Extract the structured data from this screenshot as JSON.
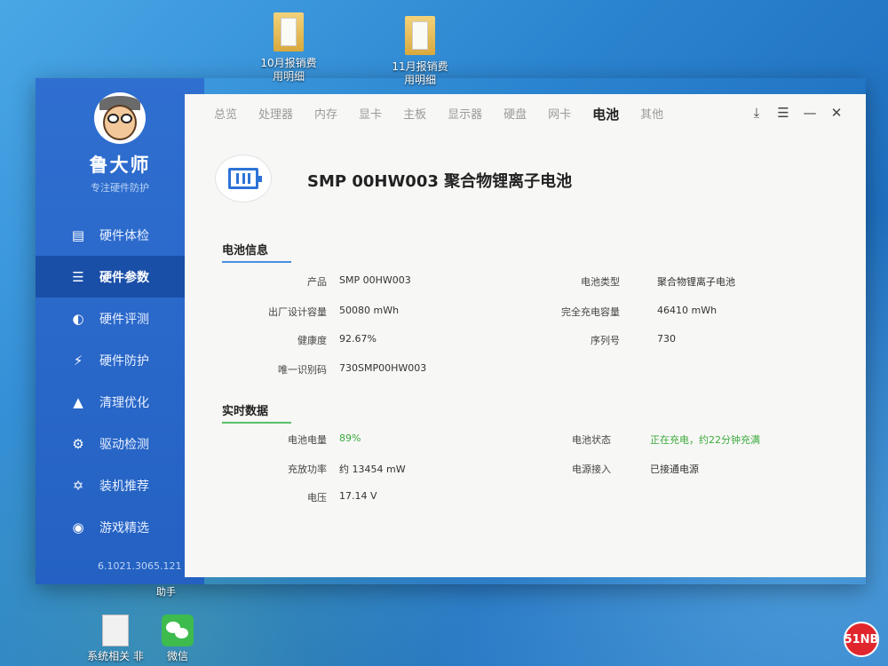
{
  "desktop": {
    "icons_top": [
      {
        "label": "10月报销费",
        "label2": "用明细"
      },
      {
        "label": "11月报销费",
        "label2": "用明细"
      }
    ],
    "icons_bottom": [
      {
        "label": "系统相关 非"
      },
      {
        "label": "微信"
      }
    ],
    "partial_label": "助手",
    "watermark": "51NB"
  },
  "sidebar": {
    "brand": "鲁大师",
    "slogan": "专注硬件防护",
    "items": [
      {
        "label": "硬件体检",
        "icon": "monitor-pulse-icon"
      },
      {
        "label": "硬件参数",
        "icon": "list-settings-icon"
      },
      {
        "label": "硬件评测",
        "icon": "speedometer-icon"
      },
      {
        "label": "硬件防护",
        "icon": "shield-bolt-icon"
      },
      {
        "label": "清理优化",
        "icon": "broom-icon"
      },
      {
        "label": "驱动检测",
        "icon": "gear-icon"
      },
      {
        "label": "装机推荐",
        "icon": "fan-icon"
      },
      {
        "label": "游戏精选",
        "icon": "gamepad-icon"
      }
    ],
    "active_index": 1,
    "version": "6.1021.3065.121"
  },
  "tabs": [
    "总览",
    "处理器",
    "内存",
    "显卡",
    "主板",
    "显示器",
    "硬盘",
    "网卡",
    "电池",
    "其他"
  ],
  "active_tab": "电池",
  "device_title": "SMP 00HW003 聚合物锂离子电池",
  "battery_info": {
    "title": "电池信息",
    "left": [
      {
        "label": "产品",
        "value": "SMP 00HW003"
      },
      {
        "label": "出厂设计容量",
        "value": "50080 mWh"
      },
      {
        "label": "健康度",
        "value": "92.67%"
      },
      {
        "label": "唯一识别码",
        "value": "730SMP00HW003"
      }
    ],
    "right": [
      {
        "label": "电池类型",
        "value": "聚合物锂离子电池"
      },
      {
        "label": "完全充电容量",
        "value": "46410 mWh"
      },
      {
        "label": "序列号",
        "value": "730"
      }
    ]
  },
  "realtime": {
    "title": "实时数据",
    "left": [
      {
        "label": "电池电量",
        "value": "89%"
      },
      {
        "label": "充放功率",
        "value": "约 13454 mW"
      },
      {
        "label": "电压",
        "value": "17.14 V"
      }
    ],
    "right": [
      {
        "label": "电池状态",
        "value": "正在充电，约22分钟充满"
      },
      {
        "label": "电源接入",
        "value": "已接通电源"
      }
    ]
  },
  "colors": {
    "sidebar": "#2f6fd0",
    "active_nav": "#1a4fa8",
    "accent_green": "#3daa3d",
    "battery_blue": "#2c73d6"
  }
}
